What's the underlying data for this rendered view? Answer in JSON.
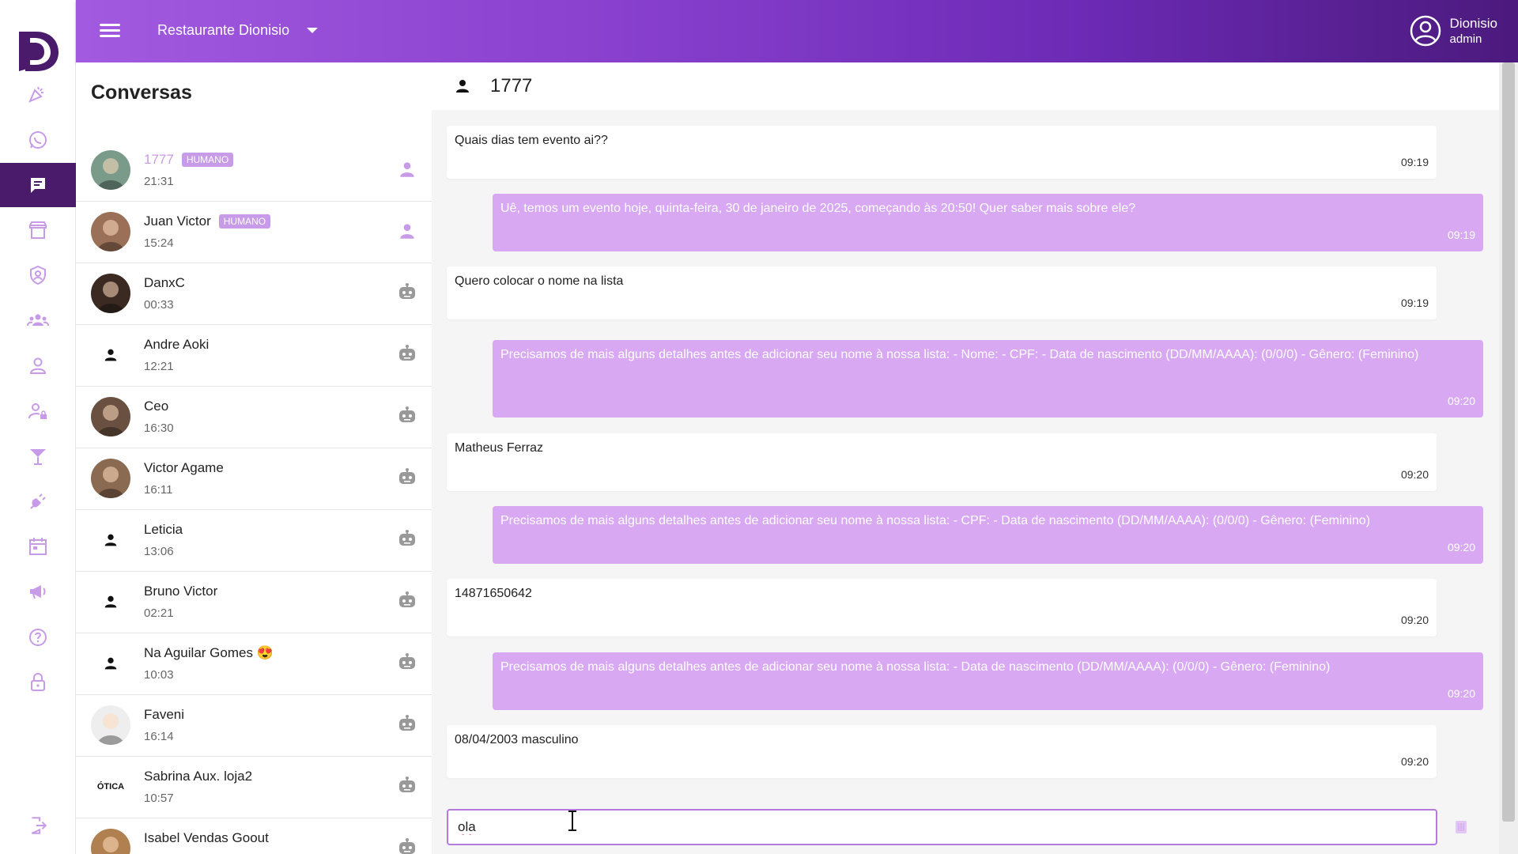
{
  "topbar": {
    "restaurant": "Restaurante Dionisio",
    "user_name": "Dionisio",
    "user_role": "admin"
  },
  "sidebar": {
    "logo_letter": "D",
    "items": [
      {
        "icon": "party-popper-icon"
      },
      {
        "icon": "whatsapp-icon"
      },
      {
        "icon": "chat-icon",
        "active": true
      },
      {
        "icon": "store-icon"
      },
      {
        "icon": "shield-user-icon"
      },
      {
        "icon": "group-icon"
      },
      {
        "icon": "person-icon"
      },
      {
        "icon": "person-lock-icon"
      },
      {
        "icon": "cocktail-icon"
      },
      {
        "icon": "plug-icon"
      },
      {
        "icon": "calendar-icon"
      },
      {
        "icon": "megaphone-icon"
      },
      {
        "icon": "help-chat-icon"
      },
      {
        "icon": "lock-icon"
      }
    ],
    "logout_icon": "logout-icon"
  },
  "conversations": {
    "title": "Conversas",
    "items": [
      {
        "name": "1777",
        "badge": "HUMANO",
        "time": "21:31",
        "status": "human",
        "highlight": true
      },
      {
        "name": "Juan Victor",
        "badge": "HUMANO",
        "time": "15:24",
        "status": "human"
      },
      {
        "name": "DanxC",
        "badge": "",
        "time": "00:33",
        "status": "bot"
      },
      {
        "name": "Andre Aoki",
        "badge": "",
        "time": "12:21",
        "status": "bot"
      },
      {
        "name": "Ceo",
        "badge": "",
        "time": "16:30",
        "status": "bot"
      },
      {
        "name": "Victor Agame",
        "badge": "",
        "time": "16:11",
        "status": "bot"
      },
      {
        "name": "Leticia",
        "badge": "",
        "time": "13:06",
        "status": "bot"
      },
      {
        "name": "Bruno Victor",
        "badge": "",
        "time": "02:21",
        "status": "bot"
      },
      {
        "name": "Na Aguilar Gomes 😍",
        "badge": "",
        "time": "10:03",
        "status": "bot"
      },
      {
        "name": "Faveni",
        "badge": "",
        "time": "16:14",
        "status": "bot"
      },
      {
        "name": "Sabrina Aux. loja2",
        "badge": "",
        "time": "10:57",
        "status": "bot"
      },
      {
        "name": "Isabel Vendas Goout",
        "badge": "",
        "time": "",
        "status": "bot"
      }
    ]
  },
  "chat": {
    "contact": "1777",
    "messages": [
      {
        "dir": "in",
        "text": "Quais dias tem evento ai??",
        "time": "09:19"
      },
      {
        "dir": "out",
        "text": "Uê, temos um evento hoje, quinta-feira, 30 de janeiro de 2025, começando às 20:50! Quer saber mais sobre ele?",
        "time": "09:19"
      },
      {
        "dir": "in",
        "text": "Quero colocar o nome na lista",
        "time": "09:19"
      },
      {
        "dir": "out",
        "text": "Precisamos de mais alguns detalhes antes de adicionar seu nome à nossa lista: - Nome: - CPF: - Data de nascimento (DD/MM/AAAA): (0/0/0) - Gênero: (Feminino)",
        "time": "09:20"
      },
      {
        "dir": "in",
        "text": "Matheus Ferraz",
        "time": "09:20"
      },
      {
        "dir": "out",
        "text": "Precisamos de mais alguns detalhes antes de adicionar seu nome à nossa lista: - CPF: - Data de nascimento (DD/MM/AAAA): (0/0/0) - Gênero: (Feminino)",
        "time": "09:20"
      },
      {
        "dir": "in",
        "text": "14871650642",
        "time": "09:20"
      },
      {
        "dir": "out",
        "text": "Precisamos de mais alguns detalhes antes de adicionar seu nome à nossa lista: - Data de nascimento (DD/MM/AAAA): (0/0/0) - Gênero: (Feminino)",
        "time": "09:20"
      },
      {
        "dir": "in",
        "text": "08/04/2003 masculino",
        "time": "09:20"
      }
    ],
    "input_value": "ola",
    "send_icon": "send-icon"
  },
  "colors": {
    "brand_purple": "#4a1a6b",
    "bubble_out": "#d9a8f3",
    "badge": "#c79be8"
  }
}
